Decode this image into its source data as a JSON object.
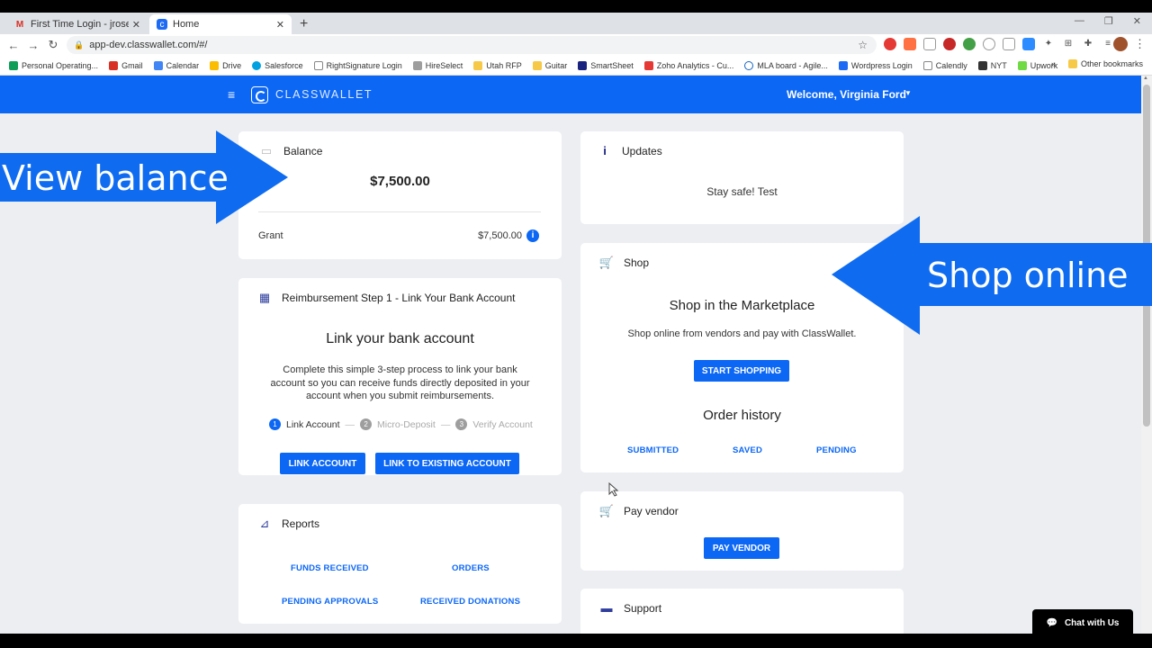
{
  "browser": {
    "tabs": [
      {
        "title": "First Time Login - jrosenberg@c",
        "icon": "gmail-icon"
      },
      {
        "title": "Home",
        "icon": "classwallet-favicon"
      }
    ],
    "url": "app-dev.classwallet.com/#/",
    "bookmarks": [
      "Personal Operating...",
      "Gmail",
      "Calendar",
      "Drive",
      "Salesforce",
      "RightSignature Login",
      "HireSelect",
      "Utah RFP",
      "Guitar",
      "SmartSheet",
      "Zoho Analytics - Cu...",
      "MLA board - Agile...",
      "Wordpress Login",
      "Calendly",
      "NYT",
      "Upwork"
    ],
    "bookmarks_more": "»",
    "other_bookmarks": "Other bookmarks"
  },
  "app": {
    "brand": "CLASSWALLET",
    "welcome": "Welcome, Virginia Ford"
  },
  "balance": {
    "title": "Balance",
    "amount": "$7,500.00",
    "grant_label": "Grant",
    "grant_amount": "$7,500.00"
  },
  "reimbursement": {
    "title": "Reimbursement Step 1 - Link Your Bank Account",
    "heading": "Link your bank account",
    "description": "Complete this simple 3-step process to link your bank account so you can receive funds directly deposited in your account when you submit reimbursements.",
    "steps": [
      {
        "num": "1",
        "label": "Link Account"
      },
      {
        "num": "2",
        "label": "Micro-Deposit"
      },
      {
        "num": "3",
        "label": "Verify Account"
      }
    ],
    "btn_link": "LINK ACCOUNT",
    "btn_existing": "LINK TO EXISTING ACCOUNT"
  },
  "reports": {
    "title": "Reports",
    "links": [
      "FUNDS RECEIVED",
      "ORDERS",
      "PENDING APPROVALS",
      "RECEIVED DONATIONS"
    ]
  },
  "updates": {
    "title": "Updates",
    "message": "Stay safe! Test"
  },
  "shop": {
    "title": "Shop",
    "heading": "Shop in the Marketplace",
    "description": "Shop online from vendors and pay with ClassWallet.",
    "btn": "START SHOPPING",
    "order_heading": "Order history",
    "order_links": [
      "SUBMITTED",
      "SAVED",
      "PENDING"
    ]
  },
  "pay_vendor": {
    "title": "Pay vendor",
    "btn": "PAY VENDOR"
  },
  "support": {
    "title": "Support"
  },
  "annotations": {
    "left_arrow": "View balance",
    "right_arrow": "Shop online"
  },
  "chat": {
    "label": "Chat with Us"
  },
  "colors": {
    "primary": "#0c67f5",
    "background": "#edeef2",
    "annotation_blue": "#0f6cf0"
  }
}
